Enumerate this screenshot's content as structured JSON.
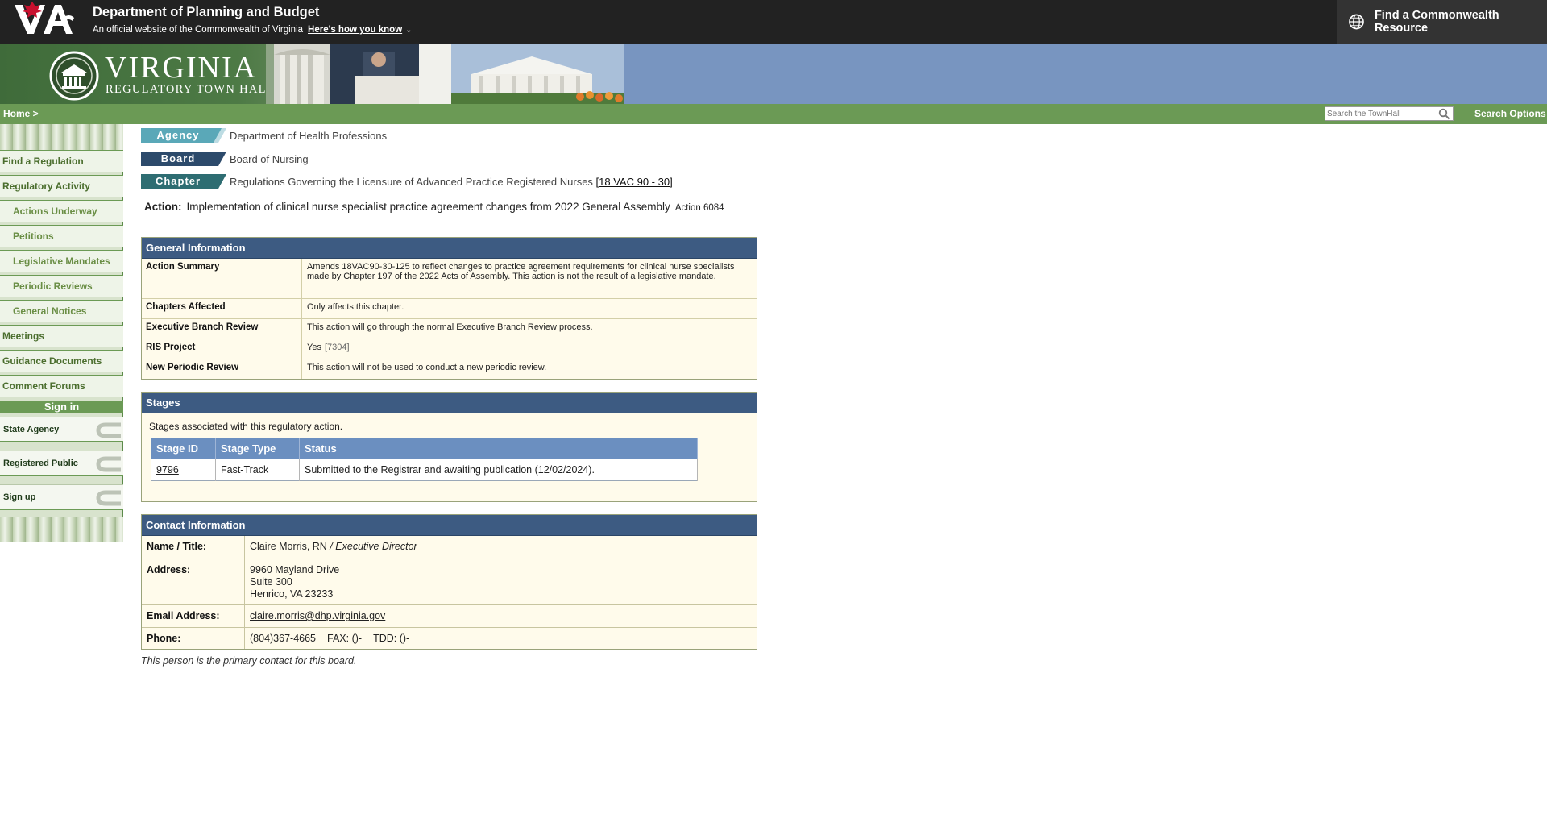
{
  "header": {
    "department": "Department of Planning and Budget",
    "official_text": "An official website of the Commonwealth of Virginia",
    "how_you_know": "Here's how you know",
    "resource_button": "Find a Commonwealth Resource"
  },
  "banner": {
    "title": "VIRGINIA",
    "subtitle": "REGULATORY TOWN HALL"
  },
  "nav": {
    "home": "Home >",
    "search_placeholder": "Search the TownHall",
    "search_options": "Search Options"
  },
  "sidebar": {
    "items": [
      {
        "label": "Find a Regulation",
        "sub": false
      },
      {
        "label": "Regulatory Activity",
        "sub": false
      },
      {
        "label": "Actions Underway",
        "sub": true
      },
      {
        "label": "Petitions",
        "sub": true
      },
      {
        "label": "Legislative Mandates",
        "sub": true
      },
      {
        "label": "Periodic Reviews",
        "sub": true
      },
      {
        "label": "General Notices",
        "sub": true
      },
      {
        "label": "Meetings",
        "sub": false
      },
      {
        "label": "Guidance Documents",
        "sub": false
      },
      {
        "label": "Comment Forums",
        "sub": false
      }
    ],
    "signin_heading": "Sign in",
    "signin_options": [
      "State Agency",
      "Registered Public",
      "Sign up"
    ]
  },
  "regulation": {
    "agency_tag": "Agency",
    "agency": "Department of Health Professions",
    "board_tag": "Board",
    "board": "Board of Nursing",
    "chapter_tag": "Chapter",
    "chapter": "Regulations Governing the Licensure of Advanced Practice Registered Nurses",
    "chapter_cite": "[18 VAC 90 - 30]",
    "action_label": "Action:",
    "action_desc": "Implementation of clinical nurse specialist practice agreement changes from 2022 General Assembly",
    "action_number": "Action 6084"
  },
  "general_info": {
    "heading": "General Information",
    "rows": [
      {
        "key": "Action Summary",
        "value": "Amends 18VAC90-30-125 to reflect changes to practice agreement requirements for clinical nurse specialists made by Chapter 197 of the 2022 Acts of Assembly. This action is not the result of a legislative mandate."
      },
      {
        "key": "Chapters Affected",
        "value": "Only affects this chapter."
      },
      {
        "key": "Executive Branch Review",
        "value": "This action will go through the normal Executive Branch Review process."
      },
      {
        "key": "RIS Project",
        "value": "Yes",
        "extra": "[7304]"
      },
      {
        "key": "New Periodic Review",
        "value": "This action will not be used to conduct a new periodic review."
      }
    ]
  },
  "stages": {
    "heading": "Stages",
    "note": "Stages associated with this regulatory action.",
    "columns": [
      "Stage ID",
      "Stage Type",
      "Status"
    ],
    "rows": [
      {
        "id": "9796",
        "type": "Fast-Track",
        "status": "Submitted to the Registrar and awaiting publication (12/02/2024)."
      }
    ]
  },
  "contact": {
    "heading": "Contact Information",
    "name_label": "Name / Title:",
    "name": "Claire Morris, RN",
    "title": "/ Executive Director",
    "address_label": "Address:",
    "address_lines": [
      "9960 Mayland Drive",
      "Suite 300",
      "Henrico, VA 23233"
    ],
    "email_label": "Email Address:",
    "email": "claire.morris@dhp.virginia.gov",
    "phone_label": "Phone:",
    "phone": "(804)367-4665",
    "fax": "FAX: ()-",
    "tdd": "TDD: ()-",
    "primary_note": "This person is the primary contact for this board."
  },
  "colors": {
    "topbar": "#222222",
    "nav_green": "#6b9a55",
    "panel_head": "#3d5b82",
    "panel_bg": "#fffbeb",
    "stage_head": "#6b8fc0"
  }
}
